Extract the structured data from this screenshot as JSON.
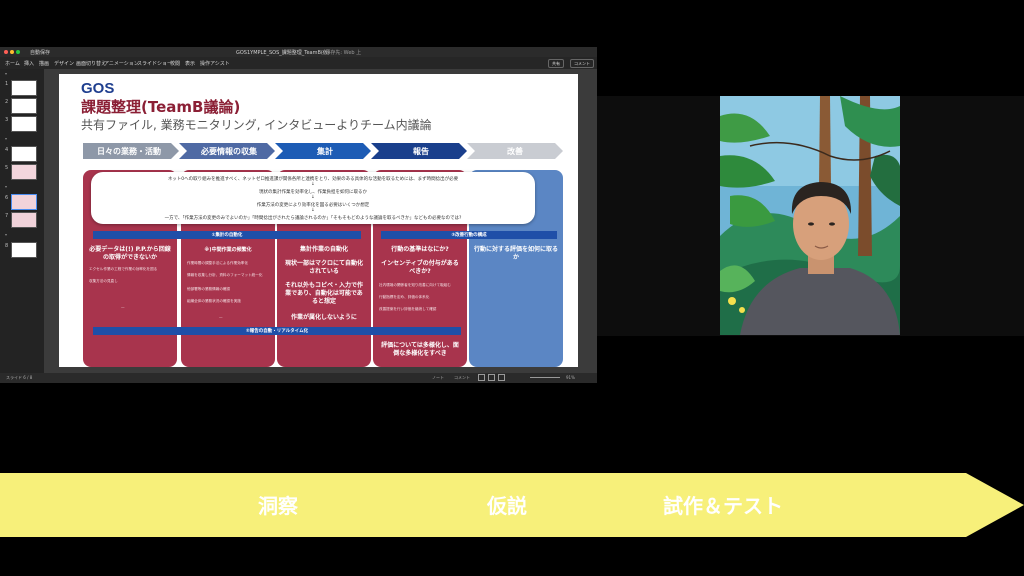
{
  "app": {
    "title_bar": "GOS1YMPLE_SOS_課題整理_TeamB(仮)",
    "title_suffix": "- 保存先: Web 上",
    "mode_label": "自動保存",
    "menus": [
      "ホーム",
      "挿入",
      "描画",
      "デザイン",
      "画面切り替え",
      "アニメーション",
      "スライドショー",
      "校閲",
      "表示",
      "操作アシスト"
    ],
    "share_label": "共有",
    "comment_label": "コメント",
    "thumb_numbers": [
      "1",
      "2",
      "3",
      "4",
      "5",
      "6",
      "7",
      "8"
    ],
    "status_left": "スライド 6 / 8",
    "status_notes": "ノート",
    "status_comments": "コメント",
    "status_zoom": "91%"
  },
  "slide": {
    "brand": "GOS",
    "title": "課題整理(TeamB議論)",
    "subtitle": "共有ファイル, 業務モニタリング, インタビューよりチーム内議論",
    "flow_steps": [
      "日々の業務・活動",
      "必要情報の収集",
      "集計",
      "報告",
      "改善"
    ],
    "bubble_lines": [
      "ネット0への取り組みを推進すべく、ネットゼロ推進課が関係各所と連携をとり、効果のある具体的な活動を取るためには、まず時間捻出が必要",
      "↓",
      "現状の集計作業を効率化し、作業負担を如何に取るか",
      "↓",
      "作業方法の変更により効率化を図る必要はいくつか想定",
      "↓",
      "一方で、「作業方法の変更のみでよいのか」「時間捻出がされたら議論されるのか」「そもそもどのような議論を取るべきか」などもの必要なのでは?"
    ],
    "bar1_label": "①集計の自動化",
    "bar3_label": "③改善行動の構成",
    "bar2_label": "②報告の自動・リアルタイム化",
    "col1_heading": "必要データは(!) P.P.から回線の取得ができないか",
    "col2_heading": "※)中間作業の頻繁化",
    "col3_heading": "集計作業の自動化",
    "col3_lines": [
      "現状一部はマクロにて自動化されている",
      "それ以外もコピペ・入力で作業であり、自動化は可能であると想定",
      "作業が属化しないように"
    ],
    "col4_heading": "行動の基準はなにか?",
    "col4_lines": [
      "インセンティブの付与があるべきか?",
      "評価については多様化し、面倒な多様化をすべき"
    ],
    "col5_heading": "行動に対する評価を如何に取るか",
    "col1_small": [
      "エクセル作業の工程で作業の効率化を図る",
      "収集方法の見直し",
      "—"
    ],
    "col2_small": [
      "作業時間の調整手法による作業効率化",
      "情報を収集し分析、資料のフォーマット統一化",
      "他部署等の業務情報の確認",
      "組織全体の業務状況の確認を実施",
      "—"
    ],
    "col4_small": [
      "社内環境の関係者を知り改善に向けて取組む",
      "行動指標を定め、評価の体系化",
      "改善提案を行い評価を継続して確認"
    ]
  },
  "banner": {
    "labels": [
      "洞察",
      "仮説",
      "試作＆テスト"
    ],
    "color": "#f7f07a"
  }
}
